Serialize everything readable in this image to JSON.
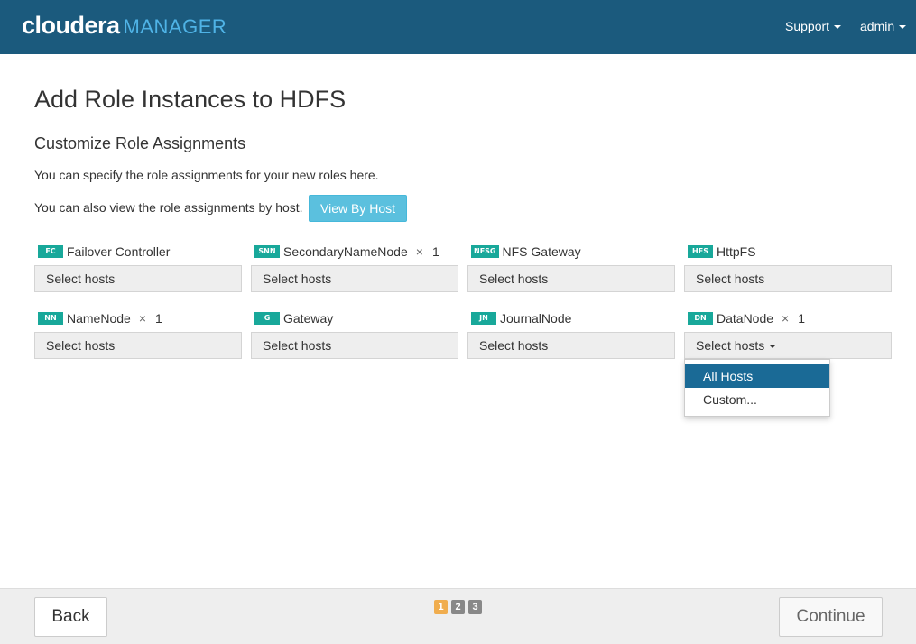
{
  "header": {
    "brand": "cloudera",
    "brand_product": "MANAGER",
    "nav": [
      {
        "label": "Support"
      },
      {
        "label": "admin"
      }
    ]
  },
  "main": {
    "title": "Add Role Instances to HDFS",
    "section_title": "Customize Role Assignments",
    "text1": "You can specify the role assignments for your new roles here.",
    "text2": "You can also view the role assignments by host.",
    "view_by_host_label": "View By Host"
  },
  "roles": [
    {
      "badge": "FC",
      "name": "Failover Controller",
      "select": "Select hosts"
    },
    {
      "badge": "SNN",
      "name": "SecondaryNameNode",
      "times": "×",
      "count": "1",
      "select": "Select hosts"
    },
    {
      "badge": "NFSG",
      "name": "NFS Gateway",
      "select": "Select hosts"
    },
    {
      "badge": "HFS",
      "name": "HttpFS",
      "select": "Select hosts"
    },
    {
      "badge": "NN",
      "name": "NameNode",
      "times": "×",
      "count": "1",
      "select": "Select hosts"
    },
    {
      "badge": "G",
      "name": "Gateway",
      "select": "Select hosts"
    },
    {
      "badge": "JN",
      "name": "JournalNode",
      "select": "Select hosts"
    },
    {
      "badge": "DN",
      "name": "DataNode",
      "times": "×",
      "count": "1",
      "select": "Select hosts"
    }
  ],
  "dropdown": {
    "items": [
      {
        "label": "All Hosts"
      },
      {
        "label": "Custom..."
      }
    ]
  },
  "footer": {
    "back_label": "Back",
    "continue_label": "Continue",
    "steps": [
      "1",
      "2",
      "3"
    ]
  },
  "colors": {
    "header_bg": "#1b5a7d",
    "brand_accent": "#4fb3e6",
    "badge": "#18a89a",
    "button_info": "#5bc0de",
    "dropdown_active": "#1a6a96",
    "step_current": "#f0ad4e"
  }
}
